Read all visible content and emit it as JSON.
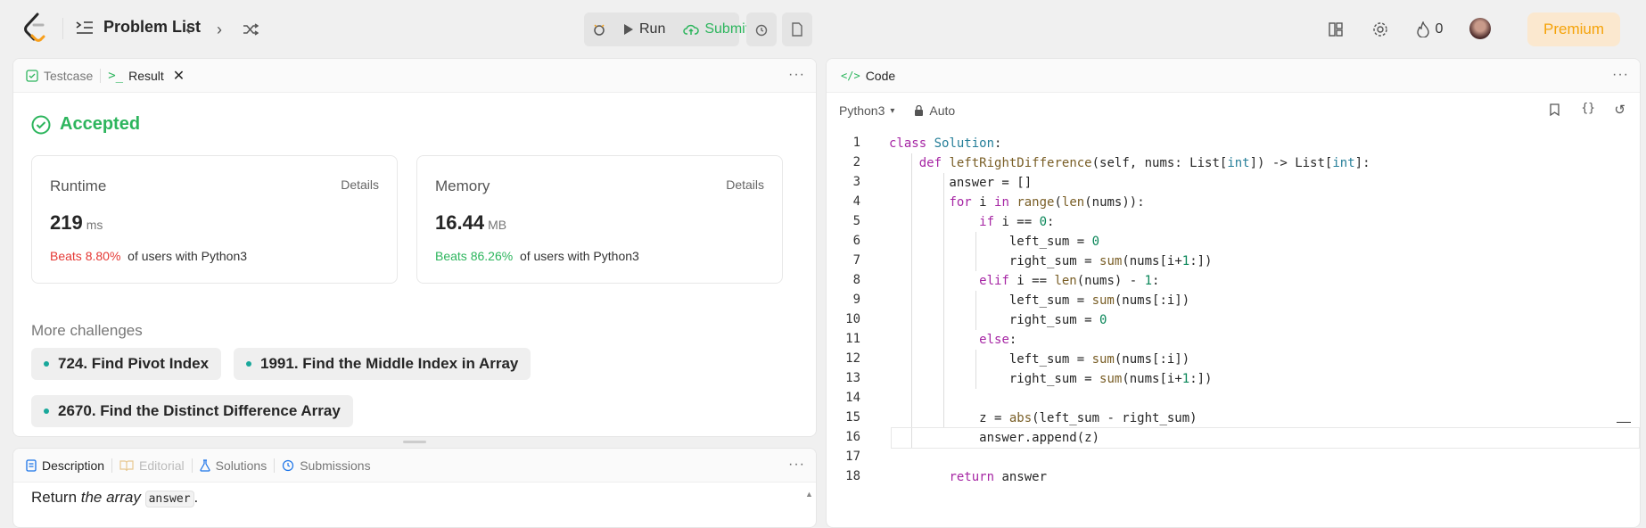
{
  "topbar": {
    "problem_list": "Problem List",
    "run": "Run",
    "submit": "Submit",
    "streak": "0",
    "premium": "Premium"
  },
  "result_panel": {
    "tab_testcase": "Testcase",
    "tab_result": "Result",
    "status": "Accepted",
    "editorial": "Editorial",
    "solution": "Solution",
    "runtime": {
      "title": "Runtime",
      "details": "Details",
      "value": "219",
      "unit": "ms",
      "beats": "Beats 8.80%",
      "suffix": "of users with Python3"
    },
    "memory": {
      "title": "Memory",
      "details": "Details",
      "value": "16.44",
      "unit": "MB",
      "beats": "Beats 86.26%",
      "suffix": "of users with Python3"
    },
    "more_title": "More challenges",
    "challenges": [
      "724. Find Pivot Index",
      "1991. Find the Middle Index in Array",
      "2670. Find the Distinct Difference Array"
    ]
  },
  "desc_panel": {
    "tabs": [
      "Description",
      "Editorial",
      "Solutions",
      "Submissions"
    ],
    "text_pre": "Return ",
    "text_em": "the array",
    "text_code": "answer",
    "text_post": "."
  },
  "code_panel": {
    "title": "Code",
    "language": "Python3",
    "mode": "Auto",
    "lines": [
      "1",
      "2",
      "3",
      "4",
      "5",
      "6",
      "7",
      "8",
      "9",
      "10",
      "11",
      "12",
      "13",
      "14",
      "15",
      "16",
      "17",
      "18"
    ]
  },
  "colors": {
    "accent_green": "#2db55d",
    "beats_red": "#e53935",
    "premium": "#f5a30a"
  }
}
